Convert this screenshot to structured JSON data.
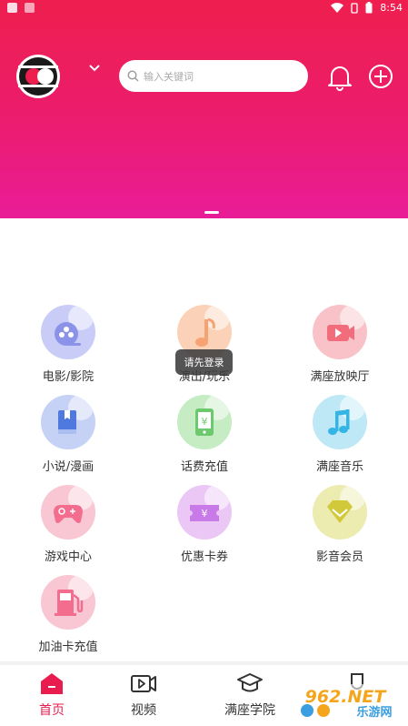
{
  "status_bar": {
    "time": "8:54"
  },
  "search": {
    "placeholder": "输入关键词"
  },
  "toast": {
    "text": "请先登录"
  },
  "grid": {
    "items": [
      {
        "label": "电影/影院",
        "icon": "film-reel-icon",
        "color": "#8b93e8"
      },
      {
        "label": "演出/玩乐",
        "icon": "music-note-icon",
        "color": "#f5a373"
      },
      {
        "label": "满座放映厅",
        "icon": "video-camera-icon",
        "color": "#f26d7c"
      },
      {
        "label": "小说/漫画",
        "icon": "book-icon",
        "color": "#7d96e8"
      },
      {
        "label": "话费充值",
        "icon": "phone-yuan-icon",
        "color": "#6cc96e"
      },
      {
        "label": "满座音乐",
        "icon": "music-icon",
        "color": "#5cc6ec"
      },
      {
        "label": "游戏中心",
        "icon": "gamepad-icon",
        "color": "#f26d8e"
      },
      {
        "label": "优惠卡券",
        "icon": "coupon-icon",
        "color": "#c77ae8"
      },
      {
        "label": "影音会员",
        "icon": "diamond-icon",
        "color": "#d9d24a"
      },
      {
        "label": "加油卡充值",
        "icon": "fuel-pump-icon",
        "color": "#f26d8e"
      }
    ]
  },
  "tabbar": {
    "tabs": [
      {
        "label": "首页",
        "icon": "home-icon",
        "active": true
      },
      {
        "label": "视频",
        "icon": "video-icon",
        "active": false
      },
      {
        "label": "满座学院",
        "icon": "graduation-cap-icon",
        "active": false
      },
      {
        "label": "",
        "icon": "profile-icon",
        "active": false
      }
    ]
  },
  "watermark": {
    "line1": "962.NET",
    "line2": "乐游网"
  },
  "colors": {
    "accent": "#e91c4f",
    "header_top": "#ee1f4e",
    "header_bottom": "#e91c98"
  }
}
